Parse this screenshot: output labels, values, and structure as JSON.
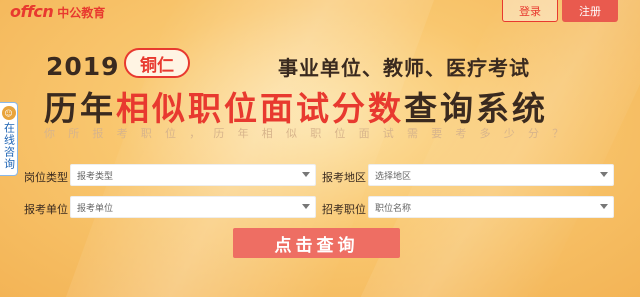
{
  "header": {
    "logo_mark": "offcn",
    "logo_text": "中公教育",
    "login_label": "登录",
    "register_label": "注册"
  },
  "banner": {
    "year": "2019",
    "city": "铜仁",
    "subtitle": "事业单位、教师、医疗考试",
    "title_part1": "历年",
    "title_part2": "相似职位面试分数",
    "title_part3": "查询系统",
    "tagline": "你所报考职位，历年相似职位面试需要考多少分？"
  },
  "side_tab": {
    "icon": "consult-avatar-icon",
    "label": "在线咨询"
  },
  "form": {
    "job_type_label": "岗位类型",
    "job_type_value": "报考类型",
    "region_label": "报考地区",
    "region_value": "选择地区",
    "unit_label": "报考单位",
    "unit_value": "报考单位",
    "position_label": "招考职位",
    "position_value": "职位名称",
    "submit_label": "点击查询"
  },
  "colors": {
    "accent": "#e8392f",
    "button": "#ee6e63",
    "text_dark": "#3a2a1f"
  }
}
